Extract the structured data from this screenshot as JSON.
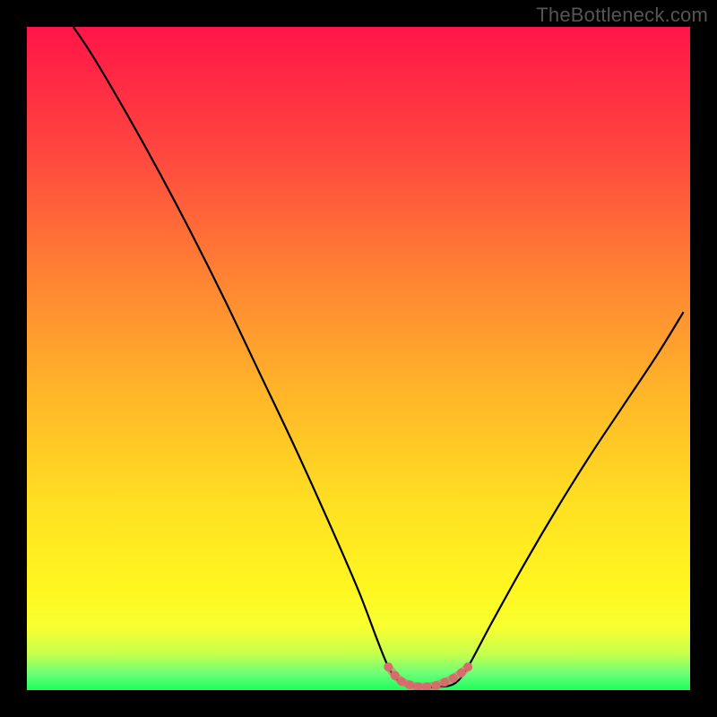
{
  "watermark": {
    "text": "TheBottleneck.com"
  },
  "colors": {
    "page_bg": "#000000",
    "curve_stroke": "#000000",
    "bottom_marker": "#d86b6b",
    "gradient_stops": [
      "#ff1548",
      "#ff4a3f",
      "#ff8433",
      "#ffb529",
      "#ffe022",
      "#fff720",
      "#f8ff30",
      "#c6ff4d",
      "#6cff78",
      "#1bff5c"
    ]
  },
  "chart_data": {
    "type": "line",
    "title": "",
    "xlabel": "",
    "ylabel": "",
    "xlim": [
      0,
      1
    ],
    "ylim": [
      0,
      1
    ],
    "series": [
      {
        "name": "bottleneck-curve",
        "x": [
          0.07,
          0.1,
          0.15,
          0.2,
          0.25,
          0.3,
          0.35,
          0.4,
          0.45,
          0.5,
          0.545,
          0.57,
          0.595,
          0.62,
          0.645,
          0.665,
          0.7,
          0.75,
          0.8,
          0.85,
          0.9,
          0.95,
          0.99
        ],
        "y": [
          1.0,
          0.955,
          0.87,
          0.78,
          0.685,
          0.585,
          0.48,
          0.375,
          0.265,
          0.15,
          0.035,
          0.01,
          0.005,
          0.005,
          0.01,
          0.035,
          0.1,
          0.19,
          0.275,
          0.355,
          0.43,
          0.505,
          0.57
        ]
      }
    ],
    "bottom_highlight": {
      "name": "optimal-range",
      "x": [
        0.545,
        0.555,
        0.565,
        0.577,
        0.59,
        0.603,
        0.617,
        0.63,
        0.643,
        0.655,
        0.665
      ],
      "y": [
        0.035,
        0.022,
        0.013,
        0.008,
        0.005,
        0.005,
        0.007,
        0.012,
        0.018,
        0.026,
        0.035
      ]
    }
  }
}
